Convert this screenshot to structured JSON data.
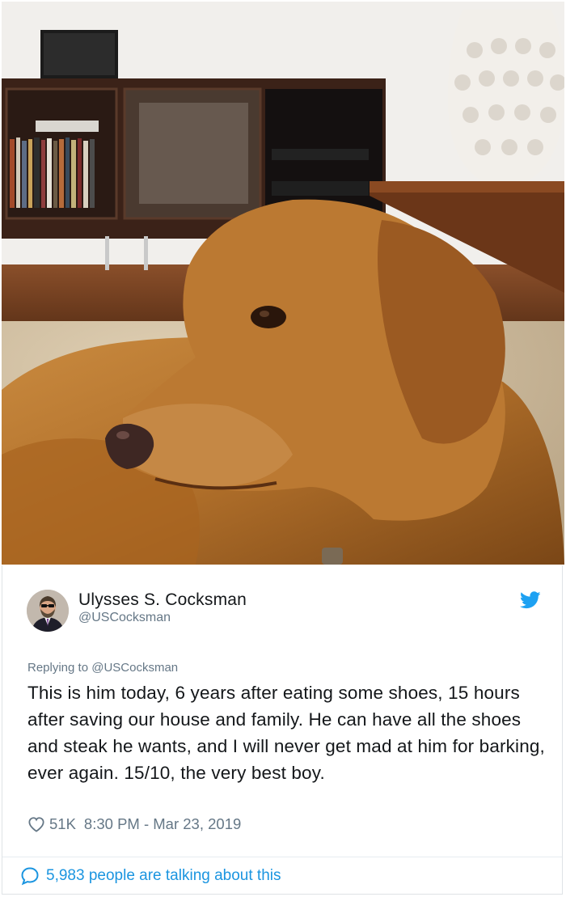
{
  "tweet": {
    "author_name": "Ulysses S. Cocksman",
    "author_handle": "@USCocksman",
    "replying_to": "Replying to @USCocksman",
    "text": "This is him today, 6 years after eating some shoes, 15 hours after saving our house and family. He can have all the shoes and steak he wants, and I will never get mad at him for barking, ever again. 15/10, the very best boy.",
    "likes": "51K",
    "timestamp": "8:30 PM - Mar 23, 2019",
    "talking": "5,983 people are talking about this"
  },
  "icons": {
    "bird": "twitter-bird-icon",
    "heart": "heart-icon",
    "comment": "speech-bubble-icon"
  },
  "colors": {
    "accent": "#1da1f2",
    "link": "#1b95e0",
    "muted": "#657786",
    "text": "#14171a"
  }
}
